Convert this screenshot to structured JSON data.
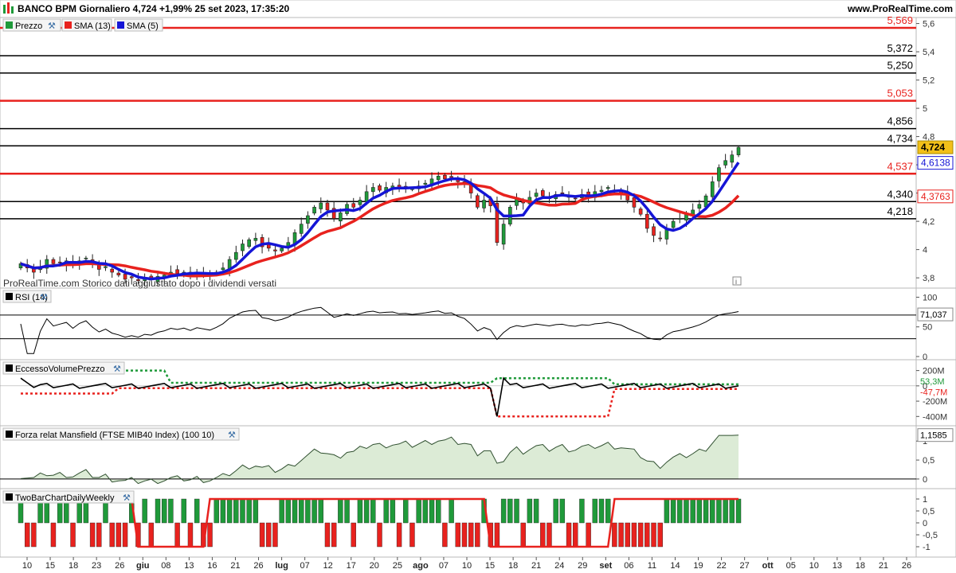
{
  "header": {
    "title": "BANCO BPM Giornaliero 4,724 +1,99% 25 set 2023, 17:35:20",
    "site": "www.ProRealTime.com"
  },
  "colors": {
    "up_candle": "#1f9a3a",
    "down_candle": "#e8221e",
    "sma13": "#e8221e",
    "sma5": "#1515d6",
    "support_red": "#e8221e",
    "support_black": "#000000",
    "price_badge": "#f2c019",
    "area_fill": "#dcebd6"
  },
  "price_panel": {
    "legend": [
      "Prezzo",
      "SMA (13)",
      "SMA (5)"
    ],
    "watermark": "ProRealTime.com Storico dati aggiustato dopo i dividendi versati",
    "info_icon": "i"
  },
  "rsi_panel": {
    "title": "RSI (14)",
    "current_label": "71,037"
  },
  "evp_panel": {
    "title": "EccessoVolumePrezzo",
    "label_up": "53,3M",
    "label_down": "-47,7M"
  },
  "mansfield_panel": {
    "title": "Forza relat Mansfield (FTSE MIB40 Index) (100 10)",
    "current_label": "1,1585"
  },
  "twobar_panel": {
    "title": "TwoBarChartDailyWeekly"
  },
  "chart_data": [
    {
      "type": "candlestick",
      "name": "Prezzo",
      "ylim": [
        3.75,
        5.62
      ],
      "y_ticks": [
        "5,6",
        "5,4",
        "5,2",
        "5",
        "4,8",
        "4,6",
        "4,4",
        "4,2",
        "4",
        "3,8"
      ],
      "y_tick_values": [
        5.6,
        5.4,
        5.2,
        5.0,
        4.8,
        4.6,
        4.4,
        4.2,
        4.0,
        3.8
      ],
      "x_ticks": [
        "10",
        "15",
        "18",
        "23",
        "26",
        "giu",
        "08",
        "13",
        "16",
        "21",
        "26",
        "lug",
        "07",
        "12",
        "17",
        "20",
        "25",
        "ago",
        "07",
        "10",
        "15",
        "18",
        "21",
        "24",
        "29",
        "set",
        "06",
        "11",
        "14",
        "19",
        "22",
        "27",
        "ott",
        "05",
        "10",
        "13",
        "18",
        "21",
        "26"
      ],
      "levels": [
        {
          "label": "5,569",
          "value": 5.569,
          "color": "red"
        },
        {
          "label": "5,372",
          "value": 5.372,
          "color": "black"
        },
        {
          "label": "5,250",
          "value": 5.25,
          "color": "black"
        },
        {
          "label": "5,053",
          "value": 5.053,
          "color": "red"
        },
        {
          "label": "4,856",
          "value": 4.856,
          "color": "black"
        },
        {
          "label": "4,734",
          "value": 4.734,
          "color": "black"
        },
        {
          "label": "4,537",
          "value": 4.537,
          "color": "red"
        },
        {
          "label": "4,340",
          "value": 4.34,
          "color": "black"
        },
        {
          "label": "4,218",
          "value": 4.218,
          "color": "black"
        }
      ],
      "last_price_label": "4,724",
      "sma5_label": "4,6138",
      "sma13_label": "4,3763",
      "closes": [
        3.9,
        3.87,
        3.84,
        3.88,
        3.93,
        3.9,
        3.91,
        3.92,
        3.89,
        3.92,
        3.94,
        3.9,
        3.86,
        3.88,
        3.84,
        3.82,
        3.79,
        3.8,
        3.78,
        3.8,
        3.79,
        3.81,
        3.82,
        3.84,
        3.83,
        3.84,
        3.82,
        3.84,
        3.83,
        3.82,
        3.84,
        3.87,
        3.93,
        3.98,
        4.04,
        4.07,
        4.08,
        4.02,
        4.01,
        3.99,
        4.01,
        4.05,
        4.12,
        4.18,
        4.24,
        4.3,
        4.33,
        4.28,
        4.22,
        4.26,
        4.32,
        4.3,
        4.35,
        4.41,
        4.44,
        4.42,
        4.44,
        4.45,
        4.43,
        4.44,
        4.43,
        4.45,
        4.47,
        4.5,
        4.52,
        4.5,
        4.51,
        4.48,
        4.46,
        4.4,
        4.3,
        4.35,
        4.31,
        4.05,
        4.18,
        4.3,
        4.36,
        4.33,
        4.37,
        4.4,
        4.38,
        4.36,
        4.39,
        4.4,
        4.37,
        4.36,
        4.39,
        4.38,
        4.41,
        4.42,
        4.44,
        4.42,
        4.4,
        4.35,
        4.3,
        4.25,
        4.15,
        4.1,
        4.08,
        4.15,
        4.2,
        4.22,
        4.25,
        4.28,
        4.32,
        4.38,
        4.48,
        4.58,
        4.63,
        4.67,
        4.724
      ]
    },
    {
      "type": "line",
      "name": "RSI (14)",
      "ylim": [
        0,
        110
      ],
      "y_ticks": [
        "100",
        "50",
        "0"
      ],
      "y_tick_values": [
        100,
        50,
        0
      ],
      "reference_lines": [
        70,
        30
      ]
    },
    {
      "type": "line",
      "name": "EccessoVolumePrezzo",
      "ylim": [
        -480,
        300
      ],
      "y_ticks": [
        "200M",
        "0",
        "-200M",
        "-400M"
      ],
      "y_tick_values": [
        200,
        0,
        -200,
        -400
      ]
    },
    {
      "type": "area",
      "name": "Forza relat Mansfield (FTSE MIB40 Index) (100 10)",
      "ylim": [
        -0.17,
        1.32
      ],
      "y_ticks": [
        "1",
        "0,5",
        "0"
      ],
      "y_tick_values": [
        1,
        0.5,
        0
      ]
    },
    {
      "type": "bar",
      "name": "TwoBarChartDailyWeekly",
      "ylim": [
        -1.3,
        1.3
      ],
      "y_ticks": [
        "1",
        "0,5",
        "0",
        "-0,5",
        "-1"
      ],
      "y_tick_values": [
        1,
        0.5,
        0,
        -0.5,
        -1
      ]
    }
  ]
}
